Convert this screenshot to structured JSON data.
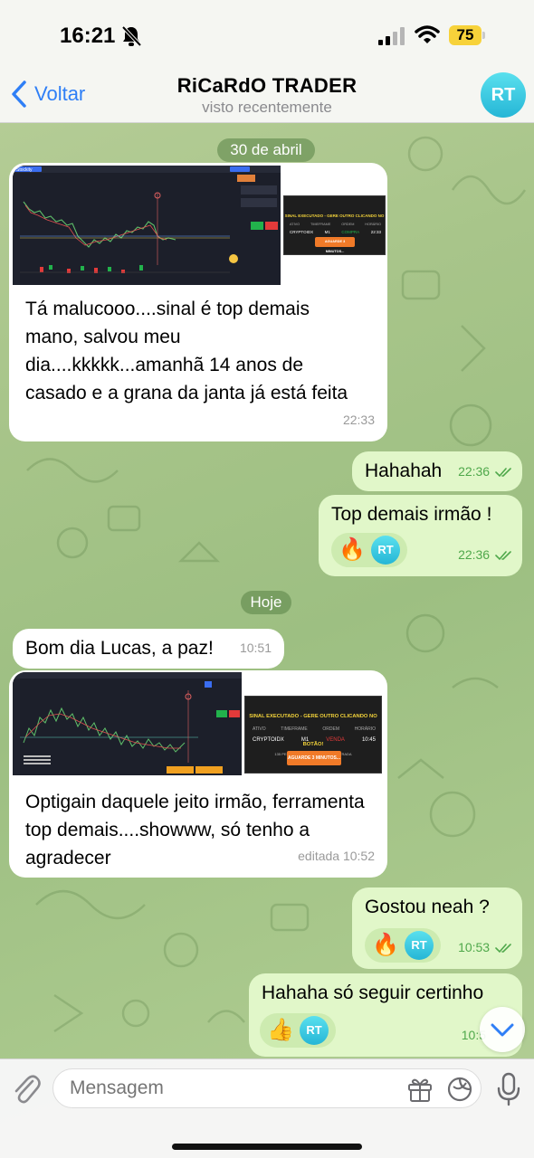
{
  "status_bar": {
    "time": "16:21",
    "battery": "75",
    "icons": [
      "bell-slash-icon",
      "signal-icon",
      "wifi-icon",
      "battery-icon"
    ]
  },
  "header": {
    "back_label": "Voltar",
    "title": "RiCaRdO TRADER",
    "subtitle": "visto recentemente",
    "avatar_initials": "RT"
  },
  "dates": {
    "first": "30 de abril",
    "second": "Hoje"
  },
  "messages": [
    {
      "direction": "in",
      "has_image": true,
      "text": "Tá malucooo....sinal é top demais mano, salvou meu dia....kkkkk...amanhã 14 anos de casado e a grana da janta já está feita",
      "time": "22:33"
    },
    {
      "direction": "out",
      "text": "Hahahah",
      "time": "22:36",
      "read": true
    },
    {
      "direction": "out",
      "text": "Top demais irmão !",
      "time": "22:36",
      "read": true,
      "reaction": "🔥",
      "reaction_avatar": "RT"
    },
    {
      "direction": "in",
      "text": "Bom dia Lucas, a paz!",
      "time": "10:51"
    },
    {
      "direction": "in",
      "has_image": true,
      "text": "Optigain daquele jeito irmão, ferramenta top demais....showww, só tenho a agradecer",
      "time": "editada 10:52"
    },
    {
      "direction": "out",
      "text": "Gostou neah ?",
      "time": "10:53",
      "read": true,
      "reaction": "🔥",
      "reaction_avatar": "RT"
    },
    {
      "direction": "out",
      "text": "Hahaha só seguir certinho",
      "time": "10:5",
      "reaction": "👍",
      "reaction_avatar": "RT"
    }
  ],
  "screenshot_1": {
    "platform_logo": "Stockity",
    "signal_title": "SINAL EXECUTADO - GERE OUTRO CLICANDO NO BOTÃO!",
    "cols": [
      "ATIVO",
      "TIMEFRAME",
      "ORDEM",
      "HORÁRIO"
    ],
    "vals": [
      "CRYPTOIDX",
      "M1",
      "COMPRA",
      "22:33"
    ],
    "button": "AGUARDE 3 MINUTOS..."
  },
  "screenshot_2": {
    "signal_title": "SINAL EXECUTADO - GERE OUTRO CLICANDO NO BOTÃO!",
    "cols": [
      "ATIVO",
      "TIMEFRAME",
      "ORDEM",
      "HORÁRIO"
    ],
    "vals": [
      "CRYPTOIDX",
      "M1",
      "VENDA",
      "10:45"
    ],
    "note": "135 PESSOAS RECEBERAM ESSA ENTRADA",
    "button": "AGUARDE 3 MINUTOS..."
  },
  "input": {
    "placeholder": "Mensagem"
  },
  "colors": {
    "accent": "#2f7ff6",
    "outgoing_bubble": "#e1f7c9",
    "incoming_bubble": "#ffffff",
    "tick": "#4fa84b",
    "buy": "#22b24c",
    "sell": "#e23a3a",
    "signal_title": "#f3d33a",
    "signal_button": "#f07a28"
  }
}
